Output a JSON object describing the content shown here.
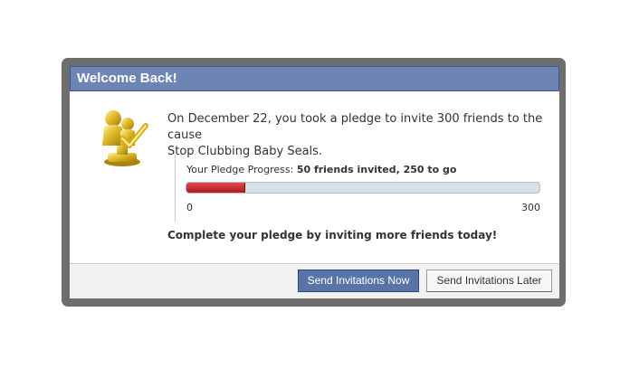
{
  "dialog": {
    "title": "Welcome Back!",
    "intro_line1": "On December 22, you took a pledge to invite 300 friends to the cause",
    "intro_line2": "Stop Clubbing Baby Seals.",
    "trophy_icon": "trophy-icon",
    "progress": {
      "label": "Your Pledge Progress: ",
      "status": "50 friends invited, 250 to go",
      "invited": 50,
      "goal": 300,
      "min_label": "0",
      "max_label": "300",
      "fill_color": "#c62828",
      "track_color": "#d8dfea"
    },
    "call_to_action": "Complete your pledge by inviting more friends today!",
    "buttons": {
      "primary": "Send Invitations Now",
      "secondary": "Send Invitations Later"
    }
  },
  "colors": {
    "titlebar": "#6d84b4",
    "primary_button": "#5b74a8",
    "frame": "#6e6e6e"
  }
}
